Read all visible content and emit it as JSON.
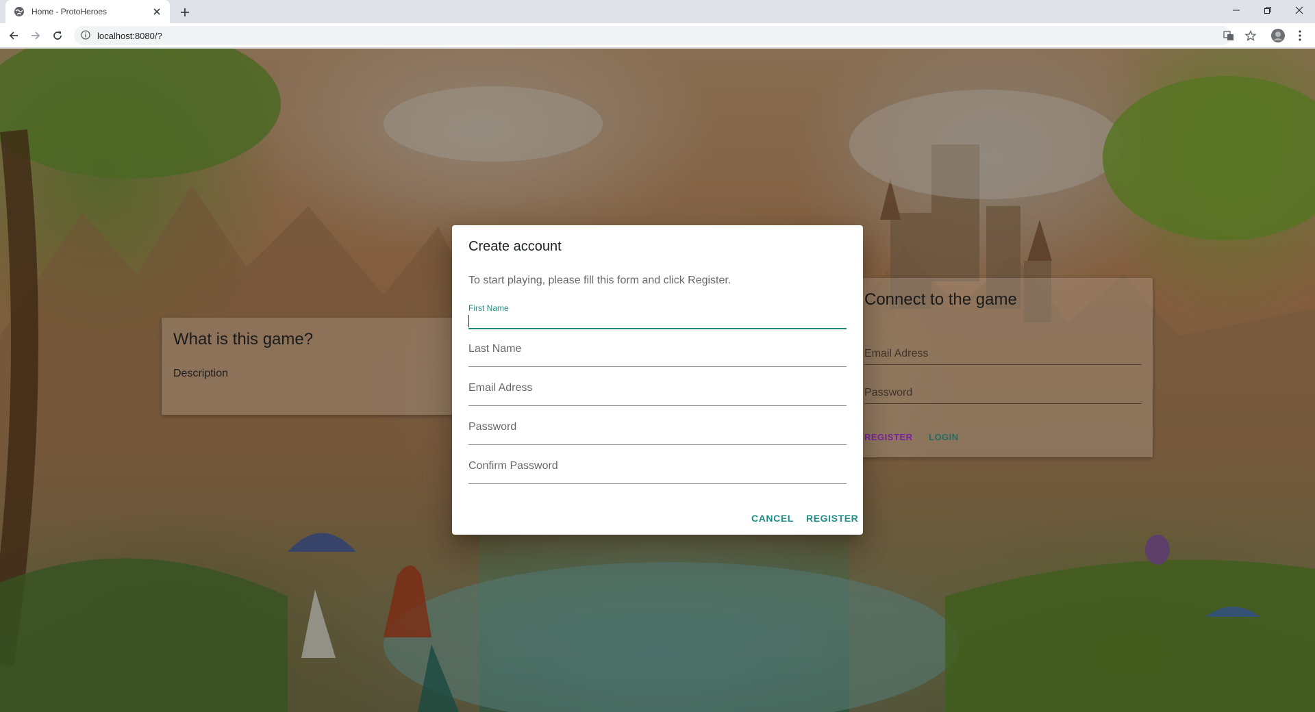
{
  "browser": {
    "tab_title": "Home - ProtoHeroes",
    "url": "localhost:8080/?"
  },
  "page": {
    "info_card": {
      "title": "What is this game?",
      "description": "Description"
    },
    "login_card": {
      "title": "Connect to the game",
      "email_label": "Email Adress",
      "password_label": "Password",
      "register_label": "REGISTER",
      "login_label": "LOGIN",
      "register_color": "#7b1fa2",
      "login_color": "#1e8e87"
    }
  },
  "dialog": {
    "title": "Create account",
    "text": "To start playing, please fill this form and click Register.",
    "fields": {
      "first_name": "First Name",
      "last_name": "Last Name",
      "email": "Email Adress",
      "password": "Password",
      "confirm_password": "Confirm Password"
    },
    "cancel_label": "CANCEL",
    "register_label": "REGISTER",
    "accent_color": "#1e8e87"
  }
}
